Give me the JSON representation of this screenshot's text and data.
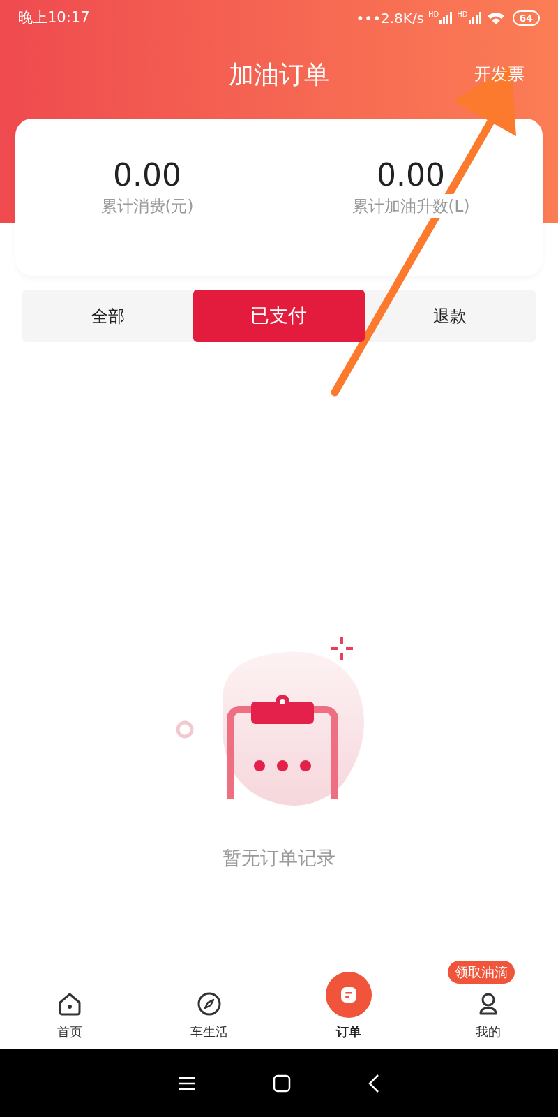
{
  "status_bar": {
    "time": "晚上10:17",
    "speed": "•••2.8K/s",
    "network_labels": [
      "HD",
      "HD"
    ],
    "battery": "64"
  },
  "header": {
    "title": "加油订单",
    "action": "开发票"
  },
  "stats": [
    {
      "value": "0.00",
      "label": "累计消费(元)"
    },
    {
      "value": "0.00",
      "label": "累计加油升数(L)"
    }
  ],
  "tabs": [
    {
      "label": "全部",
      "selected": false
    },
    {
      "label": "已支付",
      "selected": true
    },
    {
      "label": "退款",
      "selected": false
    }
  ],
  "empty_state": {
    "message": "暂无订单记录"
  },
  "bottom_nav": [
    {
      "label": "首页",
      "kind": "home",
      "selected": false
    },
    {
      "label": "车生活",
      "kind": "compass",
      "selected": false
    },
    {
      "label": "订单",
      "kind": "order",
      "selected": true
    },
    {
      "label": "我的",
      "kind": "profile",
      "selected": false,
      "badge": "领取油滴"
    }
  ]
}
